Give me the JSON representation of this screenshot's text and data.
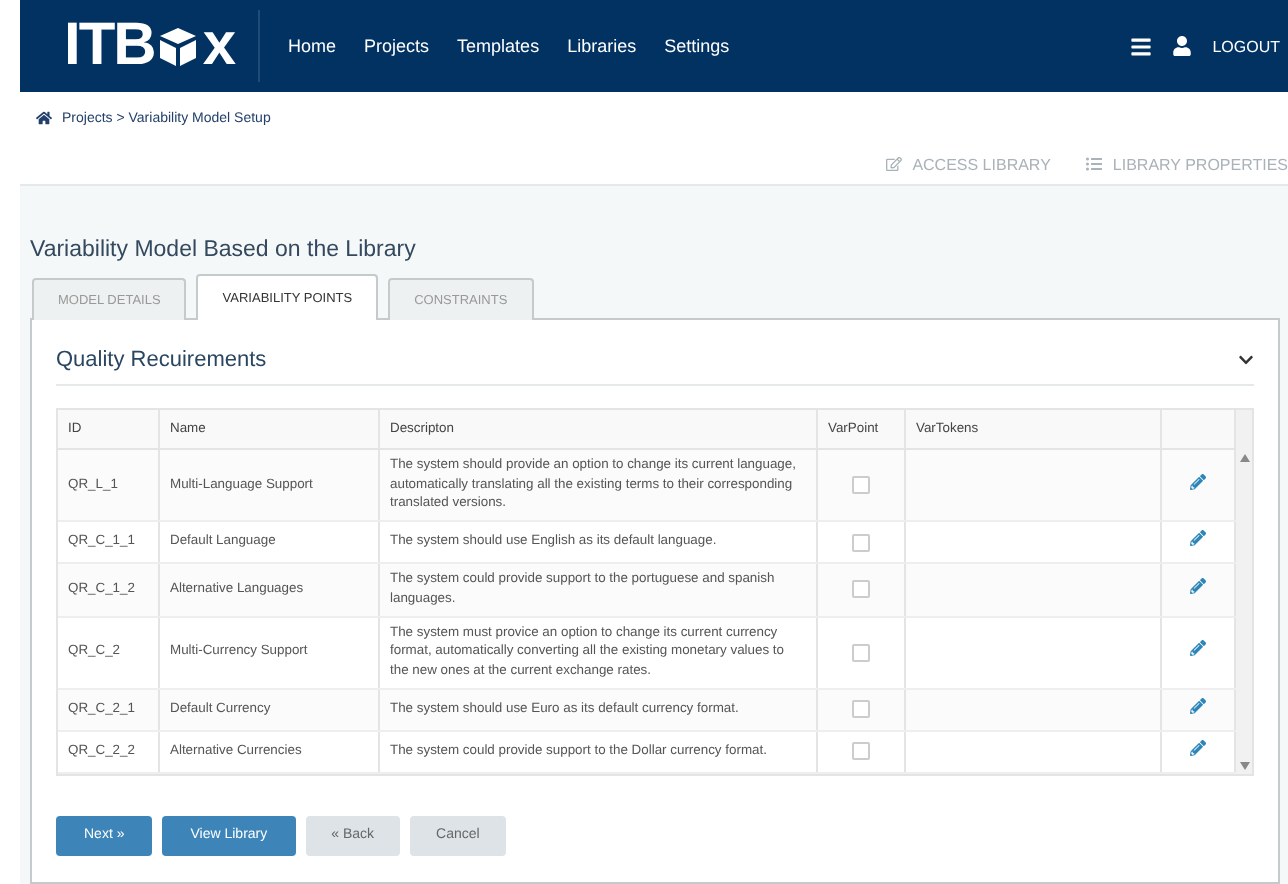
{
  "header": {
    "logo": {
      "prefix": "ITB",
      "suffix": "x"
    },
    "nav": [
      "Home",
      "Projects",
      "Templates",
      "Libraries",
      "Settings"
    ],
    "logout": "LOGOUT"
  },
  "breadcrumb": "Projects > Variability Model Setup",
  "actions": [
    {
      "kind": "edit",
      "label": "ACCESS LIBRARY"
    },
    {
      "kind": "list",
      "label": "LIBRARY PROPERTIES"
    }
  ],
  "title": "Variability Model Based on the Library",
  "tabs": [
    {
      "label": "MODEL DETAILS",
      "selected": false
    },
    {
      "label": "VARIABILITY POINTS",
      "selected": true
    },
    {
      "label": "CONSTRAINTS",
      "selected": false
    }
  ],
  "section": {
    "title": "Quality Recuirements",
    "expanded": true
  },
  "table": {
    "columns": [
      "ID",
      "Name",
      "Descripton",
      "VarPoint",
      "VarTokens"
    ],
    "rows": [
      {
        "id": "QR_L_1",
        "name": "Multi-Language Support",
        "description": "The system should provide an option to change its current language, automatically translating all the existing terms to their corresponding translated versions.",
        "varpoint": false
      },
      {
        "id": "QR_C_1_1",
        "name": "Default Language",
        "description": "The system should use English as its default language.",
        "varpoint": false
      },
      {
        "id": "QR_C_1_2",
        "name": "Alternative Languages",
        "description": "The system could provide support to the portuguese and spanish languages.",
        "varpoint": false
      },
      {
        "id": "QR_C_2",
        "name": "Multi-Currency Support",
        "description": "The system must provice an option to change its current currency format, automatically converting all the existing monetary values to the new ones at the current exchange rates.",
        "varpoint": false
      },
      {
        "id": "QR_C_2_1",
        "name": "Default Currency",
        "description": "The system should use Euro as its default currency format.",
        "varpoint": false
      },
      {
        "id": "QR_C_2_2",
        "name": "Alternative Currencies",
        "description": "The system could provide support to the Dollar currency format.",
        "varpoint": false
      }
    ]
  },
  "buttons": [
    {
      "label": "Next »",
      "kind": "primary"
    },
    {
      "label": "View Library",
      "kind": "primary"
    },
    {
      "label": "« Back",
      "kind": "secondary"
    },
    {
      "label": "Cancel",
      "kind": "secondary"
    }
  ]
}
